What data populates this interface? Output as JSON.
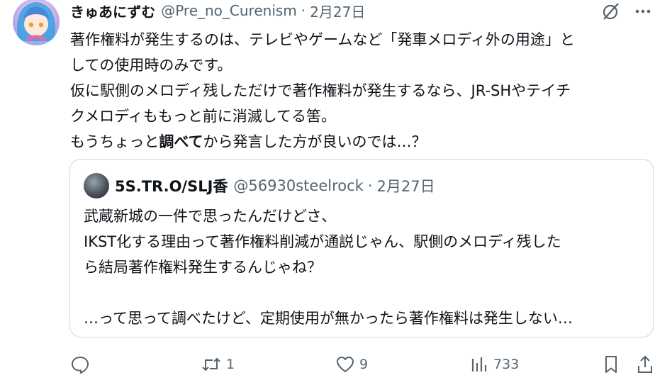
{
  "post": {
    "display_name": "きゅあにずむ",
    "handle": "@Pre_no_Curenism",
    "separator": "·",
    "date": "2月27日",
    "lines": [
      "著作権料が発生するのは、テレビやゲームなど「発車メロディ外の用途」と",
      "しての使用時のみです。",
      "仮に駅側のメロディ残しただけで著作権料が発生するなら、JR-SHやテイチ",
      "クメロディももっと前に消滅してる筈。"
    ],
    "last_line": {
      "before": "もうちょっと",
      "bold": "調べて",
      "after": "から発言した方が良いのでは…？"
    }
  },
  "quote": {
    "display_name": "5S.TR.O/SLJ香",
    "handle": "@56930steelrock",
    "separator": "·",
    "date": "2月27日",
    "lines": [
      "武蔵新城の一件で思ったんだけどさ、",
      "IKST化する理由って著作権料削減が通説じゃん、駅側のメロディ残した",
      "ら結局著作権料発生するんじゃね？",
      "",
      "…って思って調べたけど、定期使用が無かったら著作権料は発生しない…"
    ]
  },
  "actions": {
    "reposts": "1",
    "likes": "9",
    "views": "733"
  },
  "icons": {
    "reply": "reply-icon",
    "repost": "repost-icon",
    "like": "heart-icon",
    "views": "analytics-icon",
    "bookmark": "bookmark-icon",
    "share": "share-icon",
    "grok": "grok-icon",
    "more": "more-icon"
  },
  "colors": {
    "text": "#0f1419",
    "secondary": "#536471",
    "border": "#cfd9de"
  }
}
